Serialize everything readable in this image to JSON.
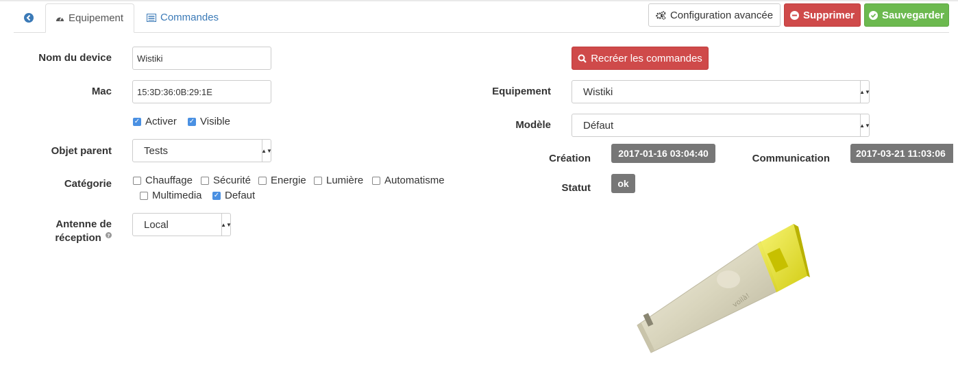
{
  "tabs": {
    "back_icon": "arrow-left-circle-icon",
    "equipement": "Equipement",
    "commandes": "Commandes"
  },
  "toolbar": {
    "config": "Configuration avancée",
    "delete": "Supprimer",
    "save": "Sauvegarder"
  },
  "form": {
    "name_label": "Nom du device",
    "name_value": "Wistiki",
    "mac_label": "Mac",
    "mac_value": "15:3D:36:0B:29:1E",
    "activer": "Activer",
    "visible": "Visible",
    "parent_label": "Objet parent",
    "parent_value": "Tests",
    "category_label": "Catégorie",
    "categories": [
      {
        "label": "Chauffage",
        "checked": false
      },
      {
        "label": "Sécurité",
        "checked": false
      },
      {
        "label": "Energie",
        "checked": false
      },
      {
        "label": "Lumière",
        "checked": false
      },
      {
        "label": "Automatisme",
        "checked": false
      },
      {
        "label": "Multimedia",
        "checked": false
      },
      {
        "label": "Defaut",
        "checked": true
      }
    ],
    "antenna_label_1": "Antenne de",
    "antenna_label_2": "réception",
    "antenna_value": "Local"
  },
  "right": {
    "recreate": "Recréer les commandes",
    "equip_label": "Equipement",
    "equip_value": "Wistiki",
    "model_label": "Modèle",
    "model_value": "Défaut",
    "creation_label": "Création",
    "creation_value": "2017-01-16 03:04:40",
    "comm_label": "Communication",
    "comm_value": "2017-03-21 11:03:06",
    "status_label": "Statut",
    "status_value": "ok"
  },
  "device_image": {
    "brand_text": "voilà!",
    "accent_color": "#e6e200"
  },
  "colors": {
    "danger": "#cf4a4a",
    "success": "#6cb94f",
    "link": "#3b7ab7",
    "badge": "#777777"
  }
}
